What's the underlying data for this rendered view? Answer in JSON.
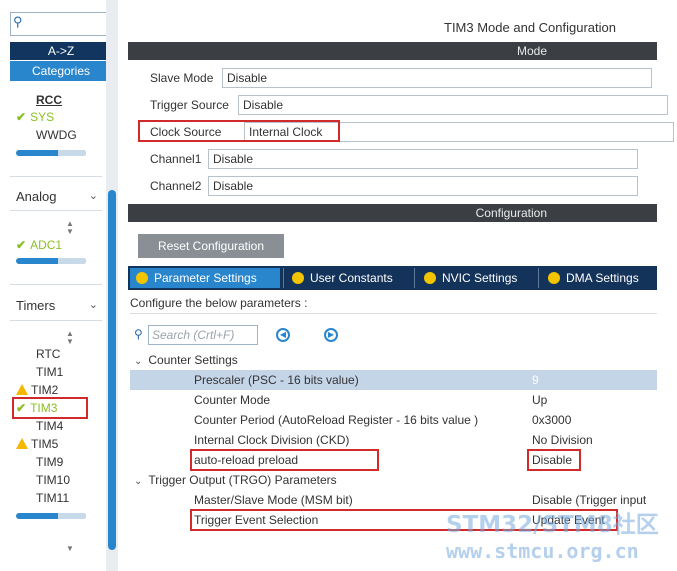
{
  "sidebar": {
    "search_value": "",
    "sort_label": "A->Z",
    "categories_label": "Categories",
    "system_items": [
      {
        "label": "RCC",
        "state": "bold"
      },
      {
        "label": "SYS",
        "state": "checked"
      },
      {
        "label": "WWDG",
        "state": "none"
      }
    ],
    "analog": {
      "label": "Analog",
      "items": [
        {
          "label": "ADC1",
          "state": "checked"
        }
      ]
    },
    "timers": {
      "label": "Timers",
      "items": [
        {
          "label": "RTC",
          "state": "none"
        },
        {
          "label": "TIM1",
          "state": "none"
        },
        {
          "label": "TIM2",
          "state": "warning"
        },
        {
          "label": "TIM3",
          "state": "checked-selected"
        },
        {
          "label": "TIM4",
          "state": "none"
        },
        {
          "label": "TIM5",
          "state": "warning"
        },
        {
          "label": "TIM9",
          "state": "none"
        },
        {
          "label": "TIM10",
          "state": "none"
        },
        {
          "label": "TIM11",
          "state": "none"
        }
      ]
    }
  },
  "main": {
    "title": "TIM3 Mode and Configuration",
    "mode_header": "Mode",
    "mode_rows": [
      {
        "label": "Slave Mode",
        "value": "Disable"
      },
      {
        "label": "Trigger Source",
        "value": "Disable"
      },
      {
        "label": "Clock Source",
        "value": "Internal Clock"
      },
      {
        "label": "Channel1",
        "value": "Disable"
      },
      {
        "label": "Channel2",
        "value": "Disable"
      }
    ],
    "config_header": "Configuration",
    "reset_button": "Reset Configuration",
    "tabs": [
      "Parameter Settings",
      "User Constants",
      "NVIC Settings",
      "DMA Settings"
    ],
    "configure_text": "Configure the below parameters :",
    "search_placeholder": "Search (Crtl+F)",
    "counter_group": "Counter Settings",
    "counter_params": [
      {
        "name": "Prescaler (PSC - 16 bits value)",
        "value": "9"
      },
      {
        "name": "Counter Mode",
        "value": "Up"
      },
      {
        "name": "Counter Period (AutoReload Register - 16 bits value )",
        "value": "0x3000"
      },
      {
        "name": "Internal Clock Division (CKD)",
        "value": "No Division"
      },
      {
        "name": "auto-reload preload",
        "value": "Disable"
      }
    ],
    "trgo_group": "Trigger Output (TRGO) Parameters",
    "trgo_params": [
      {
        "name": "Master/Slave Mode (MSM bit)",
        "value": "Disable (Trigger input"
      },
      {
        "name": "Trigger Event Selection",
        "value": "Update Event"
      }
    ]
  },
  "watermark": {
    "line1": "STM32/STM8社区",
    "line2": "www.stmcu.org.cn"
  },
  "colors": {
    "dark_bar": "#3b3f44",
    "tab_bar": "#14335a",
    "accent_blue": "#2a86cc",
    "highlight_red": "#d02a2a",
    "check_green": "#8cbf26",
    "warning_yellow": "#f5b800"
  }
}
